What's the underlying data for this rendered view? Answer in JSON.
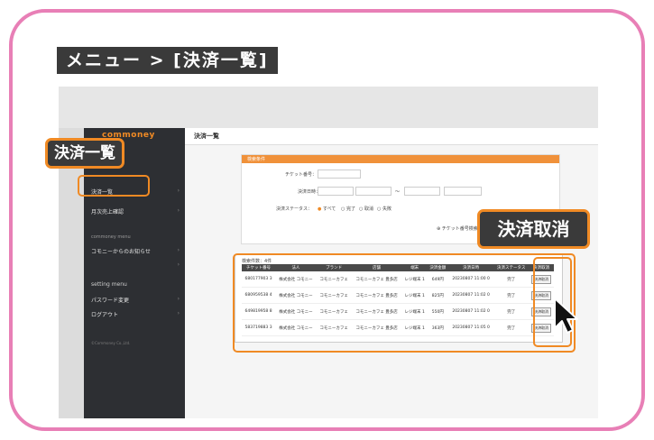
{
  "heading": "メニュー > [決済一覧]",
  "sidebar": {
    "logo": "commoney",
    "items": [
      {
        "label": "決済一覧"
      },
      {
        "label": "月次売上確認"
      },
      {
        "label": "commoney menu"
      },
      {
        "label": "コモニーからのお知らせ"
      },
      {
        "label": "setting menu"
      },
      {
        "label": "パスワード変更"
      },
      {
        "label": "ログアウト"
      },
      {
        "label": "©Commoney Co.,Ltd."
      }
    ]
  },
  "main": {
    "page_title": "決済一覧",
    "search": {
      "header": "検索条件",
      "ticket_label": "チケット番号：",
      "date_label": "決済日時：",
      "status_label": "決済ステータス：",
      "status_options": [
        "すべて",
        "完了",
        "取消",
        "失敗"
      ],
      "search_link": "チケット番号検索"
    },
    "results_count": "検索件数：4件",
    "table": {
      "columns": [
        "チケット番号",
        "法人",
        "ブランド",
        "店舗",
        "端末",
        "決済金額",
        "決済日時",
        "決済ステータス",
        "決済取消"
      ],
      "rows": [
        [
          "680177903 3",
          "株式会社 コモニー",
          "コモニーカフェ",
          "コモニーカフェ 豊多店",
          "レジ端末 1",
          "649円",
          "20230807 11:00 0",
          "完了",
          "決済取消"
        ],
        [
          "680959538 4",
          "株式会社 コモニー",
          "コモニーカフェ",
          "コモニーカフェ 豊多店",
          "レジ端末 1",
          "825円",
          "20230807 11:02 0",
          "完了",
          "決済取消"
        ],
        [
          "649819958 8",
          "株式会社 コモニー",
          "コモニーカフェ",
          "コモニーカフェ 豊多店",
          "レジ端末 1",
          "550円",
          "20230807 11:02 0",
          "完了",
          "決済取消"
        ],
        [
          "583719883 3",
          "株式会社 コモニー",
          "コモニーカフェ",
          "コモニーカフェ 豊多店",
          "レジ端末 1",
          "363円",
          "20230807 11:05 0",
          "完了",
          "決済取消"
        ]
      ]
    }
  },
  "callouts": {
    "left": "決済一覧",
    "right": "決済取消"
  },
  "colors": {
    "accent": "#f08a24",
    "frame": "#e87fb6",
    "sidebar": "#2d2f33"
  }
}
